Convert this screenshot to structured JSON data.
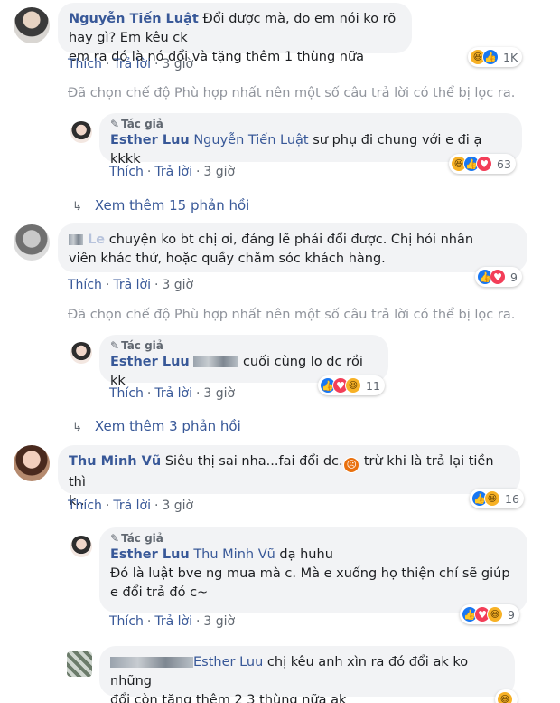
{
  "actions": {
    "like": "Thích",
    "reply": "Trả lời",
    "author_badge": "Tác giả",
    "separator": "·"
  },
  "notice": "Đã chọn chế độ Phù hợp nhất nên một số câu trả lời có thể bị lọc ra.",
  "threads": [
    {
      "name": "Nguyễn Tiến Luật",
      "text1": "Đổi được mà, do em nói ko rõ hay gì? Em kêu ck",
      "text2": "em ra đó là nó đổi và tặng thêm 1 thùng nữa",
      "time": "3 giờ",
      "reactions": [
        "haha-icon",
        "like-icon"
      ],
      "count": "1K",
      "reply": {
        "name": "Esther Luu",
        "tagged": "Nguyễn Tiến Luật",
        "text": "sư phụ đi chung với e đi ạ kkkk",
        "time": "3 giờ",
        "count": "63"
      },
      "more": "Xem thêm 15 phản hồi"
    },
    {
      "name_partial": "Le",
      "text1": "chuyện ko bt chị ơi, đáng lẽ phải đổi được. Chị hỏi nhân",
      "text2": "viên khác thử, hoặc quầy chăm sóc khách hàng.",
      "time": "3 giờ",
      "count": "9",
      "reply": {
        "name": "Esther Luu",
        "text": "cuối cùng lo dc rồi kk",
        "time": "3 giờ",
        "count": "11"
      },
      "more": "Xem thêm 3 phản hồi"
    },
    {
      "name": "Thu Minh Vũ",
      "text1": "Siêu thị sai nha...fai đổi dc.",
      "text1b": "trừ khi là trả lại tiền thì",
      "text2": "k..",
      "time": "3 giờ",
      "count": "16",
      "reply": {
        "name": "Esther Luu",
        "tagged": "Thu Minh Vũ",
        "text1": "dạ huhu",
        "text2": "Đó là luật bve ng mua mà c. Mà e xuống họ thiện chí sẽ giúp",
        "text3": "e đổi trả đó c~",
        "time": "3 giờ",
        "count": "9"
      },
      "last": {
        "tagged": "Esther Luu",
        "text1": "chị kêu anh xìn ra đó đổi ak ko những",
        "text2": "đổi còn tặng thêm 2 3 thùng nữa ak"
      }
    }
  ],
  "colors": {
    "link": "#385898",
    "bubble": "#f2f3f5",
    "muted": "#606770",
    "notice": "#90949c"
  }
}
